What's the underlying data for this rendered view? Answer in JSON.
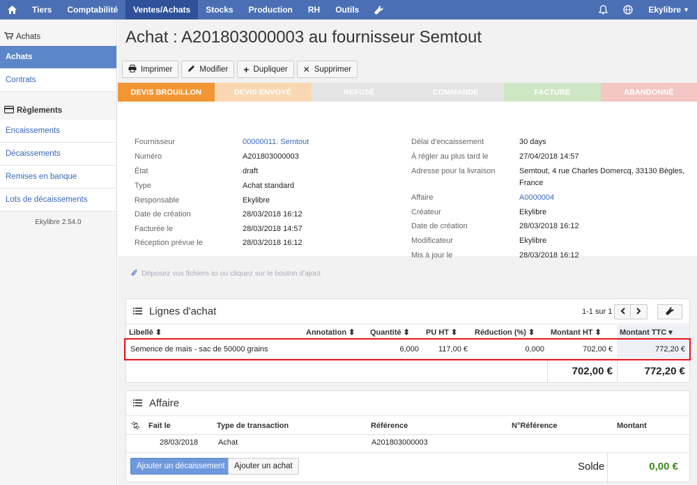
{
  "nav": {
    "items": [
      "Tiers",
      "Comptabilité",
      "Ventes/Achats",
      "Stocks",
      "Production",
      "RH",
      "Outils"
    ],
    "active": "Ventes/Achats",
    "user": "Ekylibre"
  },
  "sidebar": {
    "section1": "Achats",
    "items1": [
      "Achats",
      "Contrats"
    ],
    "section2": "Règlements",
    "items2": [
      "Encaissements",
      "Décaissements",
      "Remises en banque",
      "Lots de décaissements"
    ],
    "version": "Ekylibre 2.54.0"
  },
  "page": {
    "title": "Achat : A201803000003 au fournisseur Semtout"
  },
  "toolbar": {
    "print": "Imprimer",
    "edit": "Modifier",
    "duplicate": "Dupliquer",
    "delete": "Supprimer"
  },
  "steps": [
    {
      "label": "DEVIS BROUILLON",
      "color": "#f39634"
    },
    {
      "label": "DEVIS ENVOYÉ",
      "color": "#fad7b3"
    },
    {
      "label": "REFUSÉ",
      "color": "#e4e4e4"
    },
    {
      "label": "COMMANDE",
      "color": "#e4e4e4"
    },
    {
      "label": "FACTURE",
      "color": "#cfe6c4"
    },
    {
      "label": "ABANDONNÉ",
      "color": "#f3c7c4"
    }
  ],
  "details_left": [
    {
      "label": "Fournisseur",
      "value": "00000011. Semtout",
      "link": true
    },
    {
      "label": "Numéro",
      "value": "A201803000003"
    },
    {
      "label": "État",
      "value": "draft"
    },
    {
      "label": "Type",
      "value": "Achat standard"
    },
    {
      "label": "Responsable",
      "value": "Ekylibre"
    },
    {
      "label": "Date de création",
      "value": "28/03/2018 16:12"
    },
    {
      "label": "Facturée le",
      "value": "28/03/2018 14:57"
    },
    {
      "label": "Réception prévue le",
      "value": "28/03/2018 16:12"
    }
  ],
  "details_right": [
    {
      "label": "Délai d'encaissement",
      "value": "30 days"
    },
    {
      "label": "À régler au plus tard le",
      "value": "27/04/2018 14:57"
    },
    {
      "label": "Adresse pour la livraison",
      "value": "Semtout, 4 rue Charles Domercq, 33130 Bègles,",
      "value2": "France"
    },
    {
      "label": "Affaire",
      "value": "A0000004",
      "link": true
    },
    {
      "label": "Créateur",
      "value": "Ekylibre"
    },
    {
      "label": "Date de création",
      "value": "28/03/2018 16:12"
    },
    {
      "label": "Modificateur",
      "value": "Ekylibre"
    },
    {
      "label": "Mis à jour le",
      "value": "28/03/2018 16:12"
    }
  ],
  "dropzone": "Déposez vos fichiers ici ou cliquez sur le bouton d'ajout",
  "lines": {
    "title": "Lignes d'achat",
    "pagination": "1-1 sur 1",
    "columns": [
      "Libellé",
      "Annotation",
      "Quantité",
      "PU HT",
      "Réduction (%)",
      "Montant HT",
      "Montant TTC"
    ],
    "rows": [
      {
        "label": "Semence de maïs - sac de 50000 grains",
        "annotation": "",
        "qty": "6,000",
        "pu": "117,00 €",
        "reduction": "0,000",
        "ht": "702,00 €",
        "ttc": "772,20 €"
      }
    ],
    "total_ht": "702,00 €",
    "total_ttc": "772,20 €"
  },
  "affaire": {
    "title": "Affaire",
    "columns": [
      "Fait le",
      "Type de transaction",
      "Référence",
      "N°Référence",
      "Montant"
    ],
    "rows": [
      {
        "date": "28/03/2018",
        "type": "Achat",
        "ref": "A201803000003",
        "nref": "",
        "amount": ""
      }
    ],
    "add_payment": "Ajouter un décaissement",
    "add_purchase": "Ajouter un achat",
    "balance_label": "Solde",
    "balance_value": "0,00 €"
  }
}
